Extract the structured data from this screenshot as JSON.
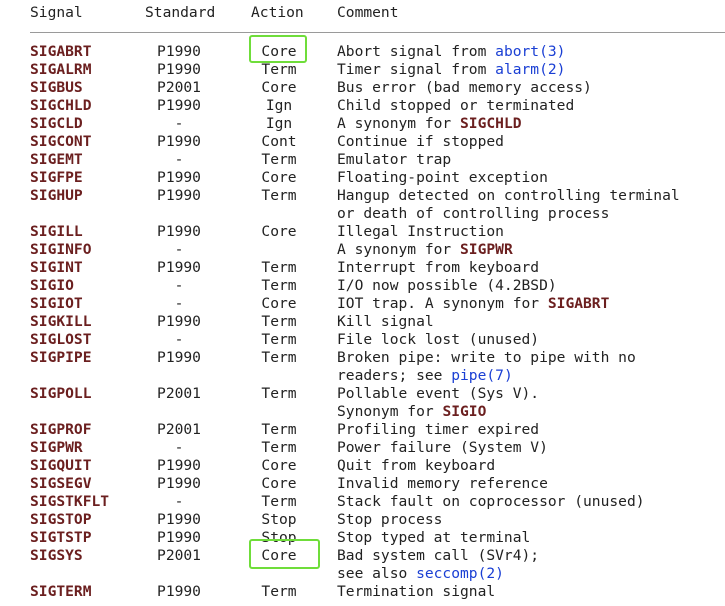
{
  "header": {
    "signal": "Signal",
    "standard": "Standard",
    "action": "Action",
    "comment": "Comment"
  },
  "rows": [
    {
      "signal": "SIGABRT",
      "standard": "P1990",
      "action": "Core",
      "highlight": true,
      "lines": [
        [
          {
            "t": "Abort signal from "
          },
          {
            "t": "abort(3)",
            "link": true
          }
        ]
      ]
    },
    {
      "signal": "SIGALRM",
      "standard": "P1990",
      "action": "Term",
      "lines": [
        [
          {
            "t": "Timer signal from "
          },
          {
            "t": "alarm(2)",
            "link": true
          }
        ]
      ]
    },
    {
      "signal": "SIGBUS",
      "standard": "P2001",
      "action": "Core",
      "lines": [
        [
          {
            "t": "Bus error (bad memory access)"
          }
        ]
      ]
    },
    {
      "signal": "SIGCHLD",
      "standard": "P1990",
      "action": "Ign",
      "lines": [
        [
          {
            "t": "Child stopped or terminated"
          }
        ]
      ]
    },
    {
      "signal": "SIGCLD",
      "standard": "-",
      "action": "Ign",
      "lines": [
        [
          {
            "t": "A synonym for "
          },
          {
            "t": "SIGCHLD",
            "ref": true
          }
        ]
      ]
    },
    {
      "signal": "SIGCONT",
      "standard": "P1990",
      "action": "Cont",
      "lines": [
        [
          {
            "t": "Continue if stopped"
          }
        ]
      ]
    },
    {
      "signal": "SIGEMT",
      "standard": "-",
      "action": "Term",
      "lines": [
        [
          {
            "t": "Emulator trap"
          }
        ]
      ]
    },
    {
      "signal": "SIGFPE",
      "standard": "P1990",
      "action": "Core",
      "lines": [
        [
          {
            "t": "Floating-point exception"
          }
        ]
      ]
    },
    {
      "signal": "SIGHUP",
      "standard": "P1990",
      "action": "Term",
      "lines": [
        [
          {
            "t": "Hangup detected on controlling terminal"
          }
        ],
        [
          {
            "t": "or death of controlling process"
          }
        ]
      ]
    },
    {
      "signal": "SIGILL",
      "standard": "P1990",
      "action": "Core",
      "lines": [
        [
          {
            "t": "Illegal Instruction"
          }
        ]
      ]
    },
    {
      "signal": "SIGINFO",
      "standard": "-",
      "action": "",
      "lines": [
        [
          {
            "t": "A synonym for "
          },
          {
            "t": "SIGPWR",
            "ref": true
          }
        ]
      ]
    },
    {
      "signal": "SIGINT",
      "standard": "P1990",
      "action": "Term",
      "lines": [
        [
          {
            "t": "Interrupt from keyboard"
          }
        ]
      ]
    },
    {
      "signal": "SIGIO",
      "standard": "-",
      "action": "Term",
      "lines": [
        [
          {
            "t": "I/O now possible (4.2BSD)"
          }
        ]
      ]
    },
    {
      "signal": "SIGIOT",
      "standard": "-",
      "action": "Core",
      "lines": [
        [
          {
            "t": "IOT trap. A synonym for "
          },
          {
            "t": "SIGABRT",
            "ref": true
          }
        ]
      ]
    },
    {
      "signal": "SIGKILL",
      "standard": "P1990",
      "action": "Term",
      "lines": [
        [
          {
            "t": "Kill signal"
          }
        ]
      ]
    },
    {
      "signal": "SIGLOST",
      "standard": "-",
      "action": "Term",
      "lines": [
        [
          {
            "t": "File lock lost (unused)"
          }
        ]
      ]
    },
    {
      "signal": "SIGPIPE",
      "standard": "P1990",
      "action": "Term",
      "lines": [
        [
          {
            "t": "Broken pipe: write to pipe with no"
          }
        ],
        [
          {
            "t": "readers; see "
          },
          {
            "t": "pipe(7)",
            "link": true
          }
        ]
      ]
    },
    {
      "signal": "SIGPOLL",
      "standard": "P2001",
      "action": "Term",
      "lines": [
        [
          {
            "t": "Pollable event (Sys V)."
          }
        ],
        [
          {
            "t": "Synonym for "
          },
          {
            "t": "SIGIO",
            "ref": true
          }
        ]
      ]
    },
    {
      "signal": "SIGPROF",
      "standard": "P2001",
      "action": "Term",
      "lines": [
        [
          {
            "t": "Profiling timer expired"
          }
        ]
      ]
    },
    {
      "signal": "SIGPWR",
      "standard": "-",
      "action": "Term",
      "lines": [
        [
          {
            "t": "Power failure (System V)"
          }
        ]
      ]
    },
    {
      "signal": "SIGQUIT",
      "standard": "P1990",
      "action": "Core",
      "lines": [
        [
          {
            "t": "Quit from keyboard"
          }
        ]
      ]
    },
    {
      "signal": "SIGSEGV",
      "standard": "P1990",
      "action": "Core",
      "lines": [
        [
          {
            "t": "Invalid memory reference"
          }
        ]
      ]
    },
    {
      "signal": "SIGSTKFLT",
      "standard": "-",
      "action": "Term",
      "lines": [
        [
          {
            "t": "Stack fault on coprocessor (unused)"
          }
        ]
      ]
    },
    {
      "signal": "SIGSTOP",
      "standard": "P1990",
      "action": "Stop",
      "lines": [
        [
          {
            "t": "Stop process"
          }
        ]
      ]
    },
    {
      "signal": "SIGTSTP",
      "standard": "P1990",
      "action": "Stop",
      "lines": [
        [
          {
            "t": "Stop typed at terminal"
          }
        ]
      ]
    },
    {
      "signal": "SIGSYS",
      "standard": "P2001",
      "action": "Core",
      "highlight": true,
      "lines": [
        [
          {
            "t": "Bad system call (SVr4);"
          }
        ],
        [
          {
            "t": "see also "
          },
          {
            "t": "seccomp(2)",
            "link": true
          }
        ]
      ]
    },
    {
      "signal": "SIGTERM",
      "standard": "P1990",
      "action": "Term",
      "lines": [
        [
          {
            "t": "Termination signal"
          }
        ]
      ]
    }
  ]
}
